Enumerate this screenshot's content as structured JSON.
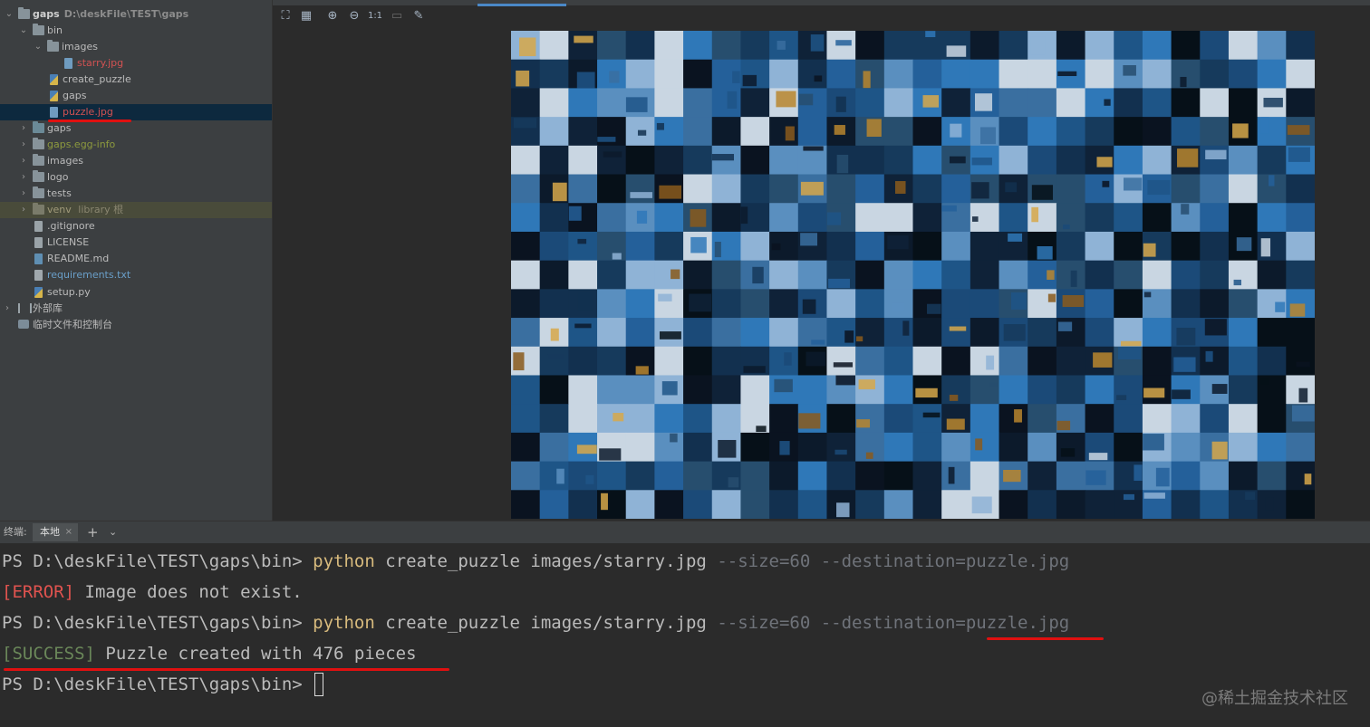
{
  "project_tree": {
    "items": [
      {
        "label": "gaps",
        "path": "D:\\deskFile\\TEST\\gaps",
        "kind": "folder",
        "expanded": true
      },
      {
        "label": "bin",
        "kind": "folder",
        "expanded": true
      },
      {
        "label": "images",
        "kind": "folder",
        "expanded": true
      },
      {
        "label": "starry.jpg",
        "kind": "image"
      },
      {
        "label": "create_puzzle",
        "kind": "python"
      },
      {
        "label": "gaps",
        "kind": "python"
      },
      {
        "label": "puzzle.jpg",
        "kind": "image",
        "selected": true
      },
      {
        "label": "gaps",
        "kind": "folder-source"
      },
      {
        "label": "gaps.egg-info",
        "kind": "folder"
      },
      {
        "label": "images",
        "kind": "folder"
      },
      {
        "label": "logo",
        "kind": "folder"
      },
      {
        "label": "tests",
        "kind": "folder"
      },
      {
        "label": "venv",
        "suffix": "library 根",
        "kind": "folder-excluded"
      },
      {
        "label": ".gitignore",
        "kind": "file"
      },
      {
        "label": "LICENSE",
        "kind": "file"
      },
      {
        "label": "README.md",
        "kind": "markdown"
      },
      {
        "label": "requirements.txt",
        "kind": "text"
      },
      {
        "label": "setup.py",
        "kind": "python"
      },
      {
        "label": "外部库",
        "kind": "library"
      },
      {
        "label": "临时文件和控制台",
        "kind": "scratch"
      }
    ]
  },
  "viewer": {
    "toolbar": [
      {
        "icon": "fit-to-window-icon",
        "glyph": "⛶"
      },
      {
        "icon": "grid-icon",
        "glyph": "▦"
      },
      {
        "icon": "zoom-in-icon",
        "glyph": "⊕"
      },
      {
        "icon": "zoom-out-icon",
        "glyph": "⊖"
      },
      {
        "icon": "actual-size-icon",
        "glyph": "1:1"
      },
      {
        "icon": "background-icon",
        "glyph": "▭"
      },
      {
        "icon": "color-picker-icon",
        "glyph": "✎"
      }
    ],
    "puzzle_grid": {
      "columns": 28,
      "rows": 17
    }
  },
  "terminal": {
    "title": "终端:",
    "tab_label": "本地",
    "tab_close": "×",
    "add_glyph": "+",
    "chevron_glyph": "⌄",
    "lines": [
      {
        "prompt": "PS D:\\deskFile\\TEST\\gaps\\bin> ",
        "cmd": "python",
        "args": " create_puzzle images/starry.jpg ",
        "opts": "--size=60 --destination=puzzle.jpg"
      },
      {
        "tag": "[ERROR]",
        "msg": " Image does not exist."
      },
      {
        "prompt": "PS D:\\deskFile\\TEST\\gaps\\bin> ",
        "cmd": "python",
        "args": " create_puzzle images/starry.jpg ",
        "opts": "--size=60 --destination=puzzle.jpg"
      },
      {
        "tag": "[SUCCESS]",
        "msg": " Puzzle created with 476 pieces"
      },
      {
        "prompt": "PS D:\\deskFile\\TEST\\gaps\\bin> "
      }
    ]
  },
  "watermark": "@稀土掘金技术社区",
  "colors": {
    "annotation_underline": "#e01010",
    "tree_background": "#3c3f41",
    "editor_background": "#2b2b2b",
    "selection": "#0d293e"
  }
}
